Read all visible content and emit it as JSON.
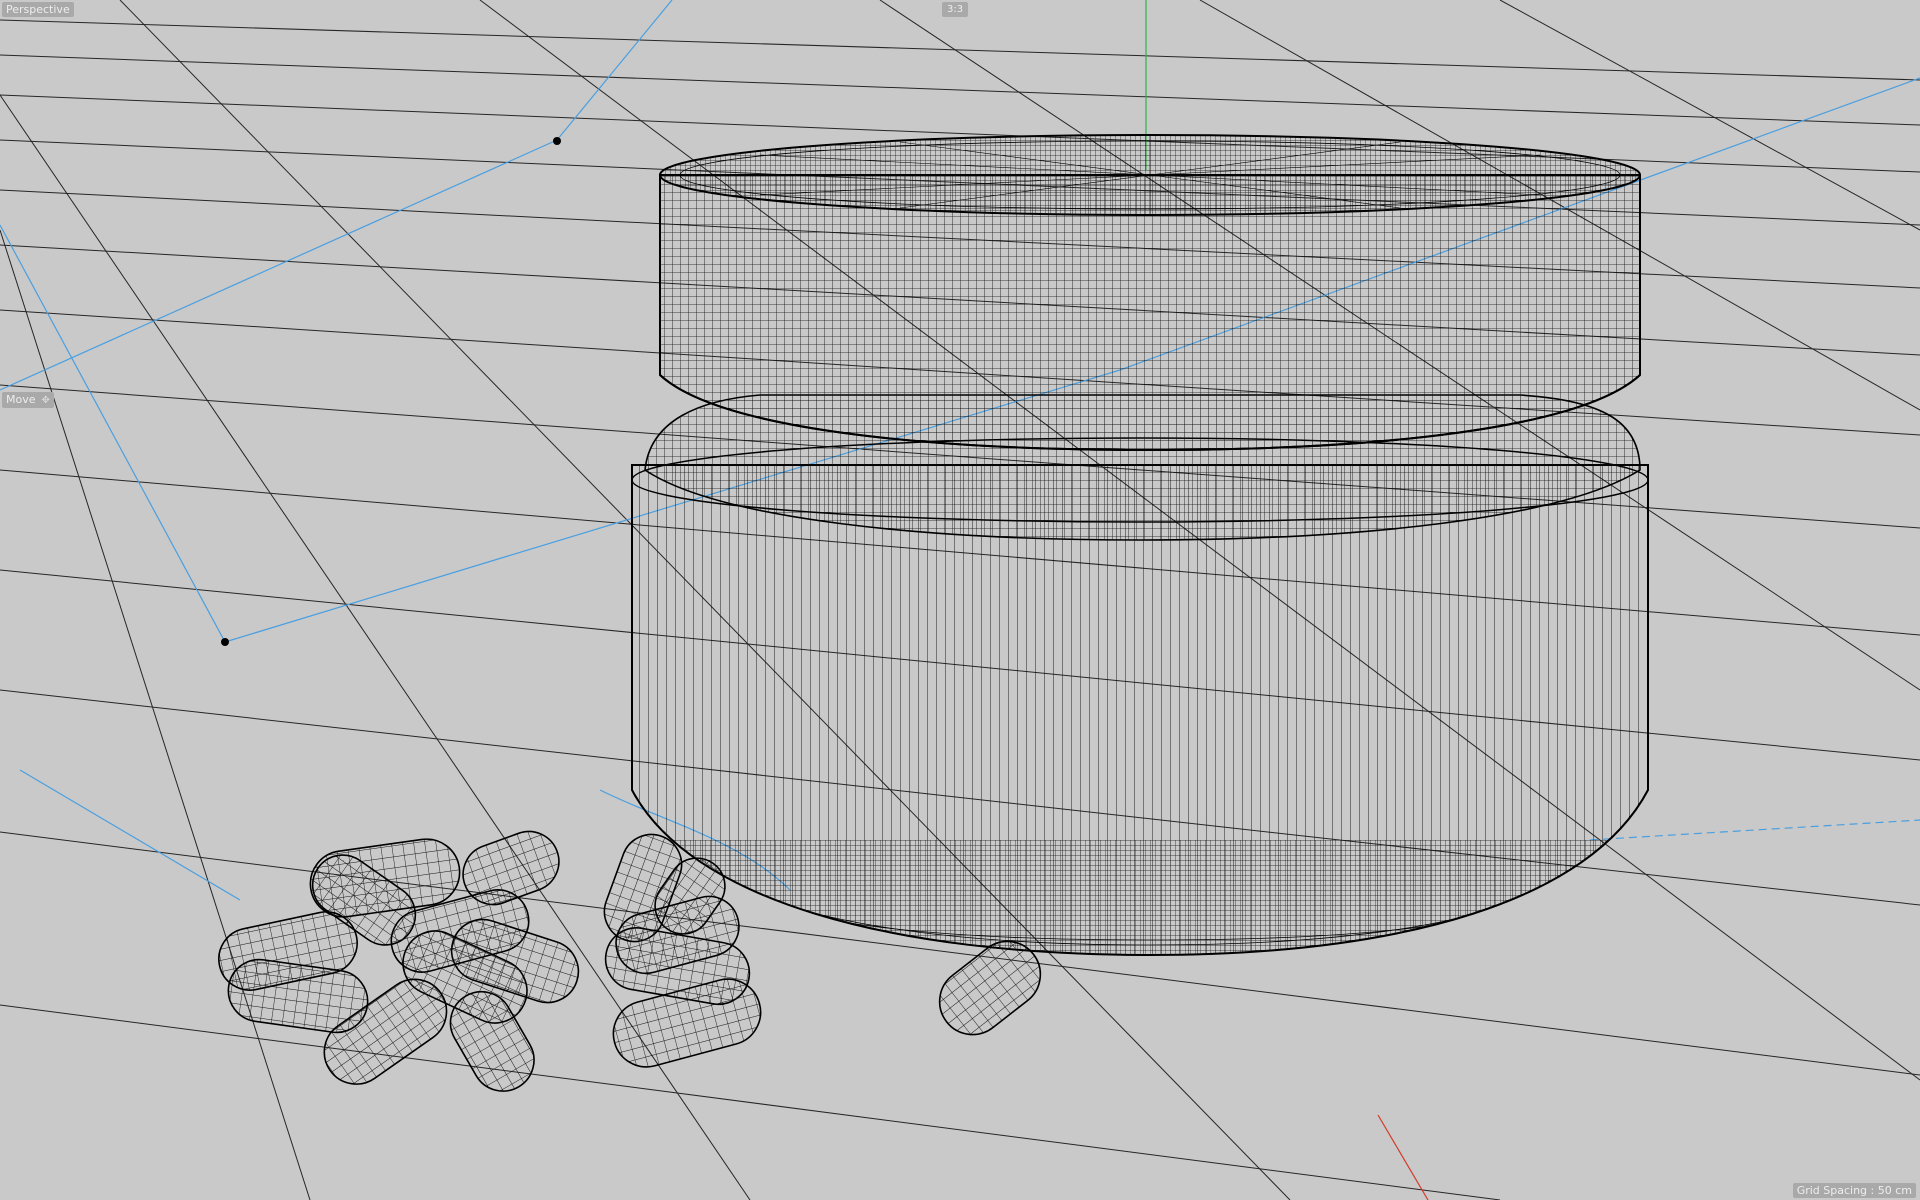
{
  "viewport": {
    "view_name": "Perspective",
    "view_badge": "3:3",
    "active_tool": "Move",
    "active_tool_icon": "move-arrows-icon",
    "grid_spacing_text": "Grid Spacing : 50 cm"
  },
  "scene": {
    "objects": [
      "jar-lid",
      "jar-body",
      "capsule-pile",
      "single-capsule",
      "spline-path",
      "floor-grid"
    ],
    "colors": {
      "background": "#c9c9c9",
      "wire": "#000000",
      "grid": "#2a2a2a",
      "spline": "#4a9fe0",
      "axis_y": "#2db54a",
      "axis_x": "#d33a2c"
    }
  }
}
